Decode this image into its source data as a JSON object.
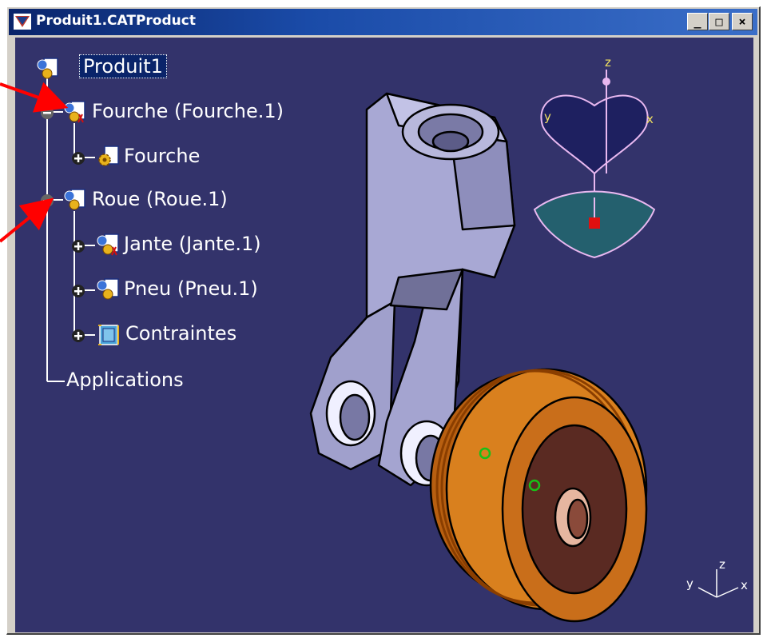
{
  "window": {
    "title": "Produit1.CATProduct",
    "controls": {
      "minimize": "_",
      "maximize": "□",
      "close": "×"
    }
  },
  "tree": {
    "root": "Produit1",
    "items": [
      {
        "label": "Fourche (Fourche.1)",
        "icon": "product-instance-icon",
        "expander": "minus"
      },
      {
        "label": "Fourche",
        "icon": "part-gear-icon",
        "expander": "plus"
      },
      {
        "label": "Roue (Roue.1)",
        "icon": "product-instance-icon",
        "expander": "minus"
      },
      {
        "label": "Jante (Jante.1)",
        "icon": "part-instance-icon",
        "expander": "plus"
      },
      {
        "label": "Pneu (Pneu.1)",
        "icon": "part-instance-icon",
        "expander": "plus"
      },
      {
        "label": "Contraintes",
        "icon": "constraints-icon",
        "expander": "plus"
      }
    ],
    "applications": "Applications"
  },
  "compass": {
    "z": "z",
    "y": "y",
    "x": "x"
  },
  "axis_triad": {
    "z": "z",
    "y": "y",
    "x": "x"
  },
  "colors": {
    "viewport_bg": "#33336b",
    "fork_body": "#b6b6dc",
    "wheel": "#d9801e",
    "annotation_arrow": "#ff0000",
    "compass": "#e8b8f0"
  }
}
